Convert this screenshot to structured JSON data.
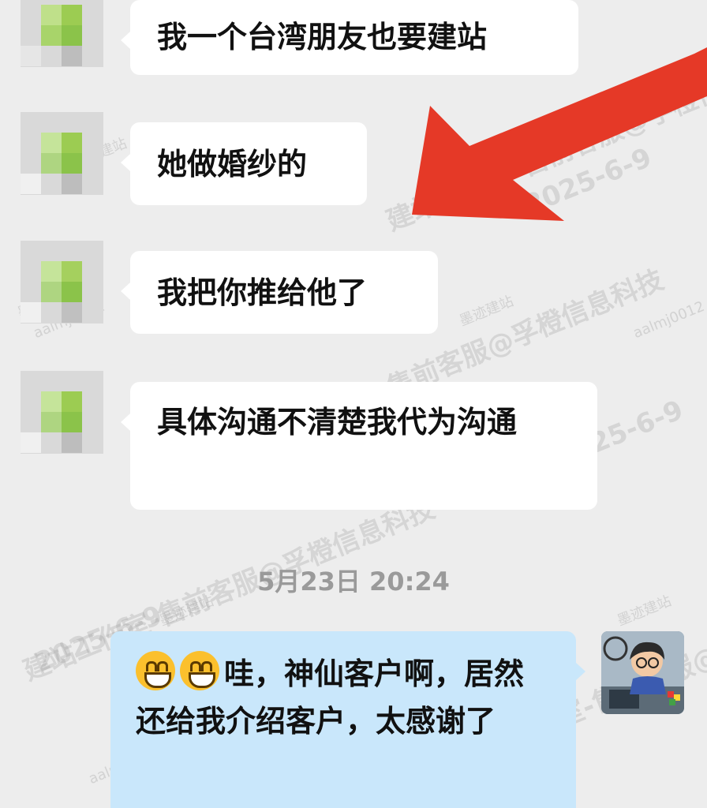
{
  "messages": [
    {
      "text": "我一个台湾朋友也要建站"
    },
    {
      "text": "她做婚纱的"
    },
    {
      "text": "我把你推给他了"
    },
    {
      "text": "具体沟通不清楚我代为沟通"
    }
  ],
  "timestamp": "5月23日  20:24",
  "reply": {
    "text": "哇，神仙客户啊，居然还给我介绍客户，太感谢了",
    "emoji": "grinning-face-icon"
  },
  "watermark": {
    "line1": "建站工作室-售前客服@孚橙信息科技",
    "date": "2025-6-9",
    "logo": "墨迹建站",
    "id": "aalmj0012"
  },
  "colors": {
    "background": "#ededed",
    "incoming_bubble": "#ffffff",
    "outgoing_bubble": "#c9e7fb",
    "arrow": "#e53927"
  }
}
